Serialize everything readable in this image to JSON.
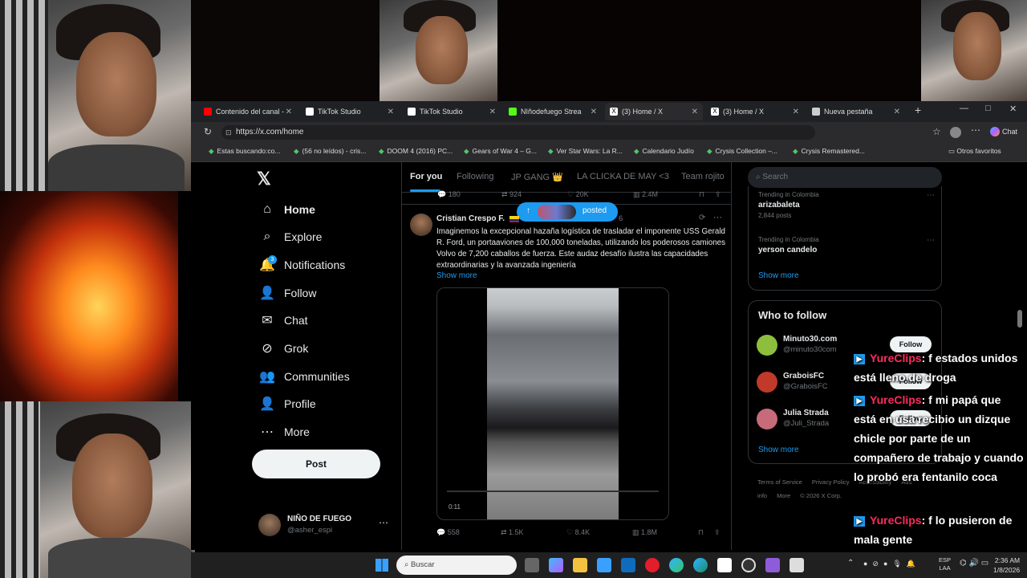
{
  "browser": {
    "tabs": [
      {
        "label": "Contenido del canal - Y",
        "icon": "youtube-icon",
        "color": "#ff0000"
      },
      {
        "label": "TikTok Studio",
        "icon": "tiktok-icon",
        "color": "#ffffff"
      },
      {
        "label": "TikTok Studio",
        "icon": "tiktok-icon",
        "color": "#ffffff"
      },
      {
        "label": "NIñodefuego Strea",
        "icon": "kick-icon",
        "color": "#53fc18"
      },
      {
        "label": "(3) Home / X",
        "icon": "x-icon",
        "color": "#ffffff"
      },
      {
        "label": "(3) Home / X",
        "icon": "x-icon",
        "color": "#ffffff"
      },
      {
        "label": "Nueva pestaña",
        "icon": "newtab-icon",
        "color": "#cccccc"
      }
    ],
    "url": "https://x.com/home",
    "chat_label": "Chat",
    "bookmarks": [
      "Estas buscando:co...",
      "(56 no leídos) - cris...",
      "DOOM 4 (2016) PC...",
      "Gears of War 4 – G...",
      "Ver Star Wars: La R...",
      "Calendario Judío",
      "Crysis Collection –...",
      "Crysis Remastered..."
    ],
    "other_bookmarks": "Otros favoritos"
  },
  "x": {
    "nav": [
      {
        "label": "Home",
        "icon": "home-icon",
        "glyph": "⌂"
      },
      {
        "label": "Explore",
        "icon": "search-icon",
        "glyph": "⌕"
      },
      {
        "label": "Notifications",
        "icon": "bell-icon",
        "glyph": "🔔"
      },
      {
        "label": "Follow",
        "icon": "follow-icon",
        "glyph": "👤"
      },
      {
        "label": "Chat",
        "icon": "mail-icon",
        "glyph": "✉"
      },
      {
        "label": "Grok",
        "icon": "grok-icon",
        "glyph": "⊘"
      },
      {
        "label": "Communities",
        "icon": "communities-icon",
        "glyph": "👥"
      },
      {
        "label": "Profile",
        "icon": "profile-icon",
        "glyph": "👤"
      },
      {
        "label": "More",
        "icon": "more-icon",
        "glyph": "⋯"
      }
    ],
    "notif_count": "3",
    "post_button": "Post",
    "account": {
      "name": "NIÑO DE FUEGO",
      "handle": "@asher_espi"
    },
    "feed_tabs": [
      "For you",
      "Following",
      "JP GANG 👑",
      "LA CLICKA DE MAY <3",
      "Team rojito"
    ],
    "prev_stats": {
      "replies": "180",
      "reposts": "924",
      "likes": "20K",
      "views": "2.4M"
    },
    "posted_pill": "posted",
    "post": {
      "author": "Cristian Crespo F.",
      "time": "6",
      "text": "Imaginemos la excepcional hazaña logística de trasladar el imponente USS Gerald R. Ford, un portaaviones de 100,000 toneladas, utilizando los poderosos camiones Volvo de 7,200 caballos de fuerza. Este audaz desafío ilustra las capacidades extraordinarias y la avanzada ingeniería",
      "show_more": "Show more",
      "video_time": "0:11",
      "replies": "558",
      "reposts": "1.5K",
      "likes": "8.4K",
      "views": "1.8M"
    },
    "search_placeholder": "Search",
    "trends": [
      {
        "context": "Trending in Colombia",
        "name": "arizabaleta",
        "posts": "2,844 posts"
      },
      {
        "context": "Trending in Colombia",
        "name": "yerson candelo",
        "posts": ""
      }
    ],
    "trends_show_more": "Show more",
    "who_to_follow": {
      "title": "Who to follow",
      "users": [
        {
          "name": "Minuto30.com",
          "handle": "@minuto30com"
        },
        {
          "name": "GraboisFC",
          "handle": "@GraboisFC"
        },
        {
          "name": "Julia Strada",
          "handle": "@Juli_Strada"
        }
      ],
      "follow_label": "Follow",
      "show_more": "Show more"
    },
    "footer": [
      "Terms of Service",
      "Privacy Policy",
      "Accessibility",
      "Ads info",
      "More",
      "© 2026 X Corp."
    ]
  },
  "overlay_chat": [
    {
      "user": "YureClips",
      "text": ": f estados unidos está lleno de droga"
    },
    {
      "user": "YureClips",
      "text": ": f mi papá que está en usa recibio un dizque chicle por parte de un compañero de trabajo y cuando lo probó era fentanilo coca"
    },
    {
      "user": "YureClips",
      "text": ": f lo pusieron de mala gente"
    }
  ],
  "taskbar": {
    "search_placeholder": "Buscar",
    "lang": "ESP",
    "lang2": "LAA",
    "time": "2:36 AM",
    "date": "1/8/2026"
  }
}
